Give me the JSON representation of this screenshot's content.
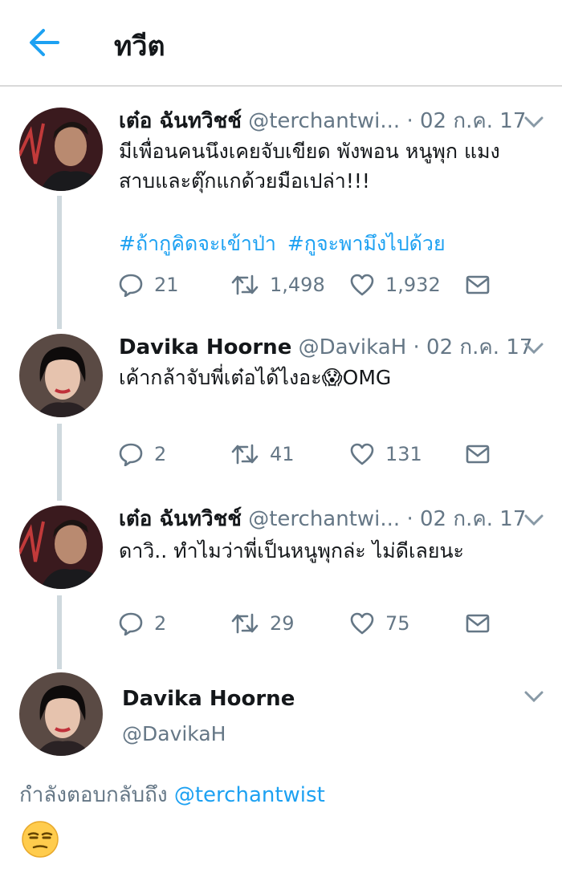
{
  "header": {
    "title": "ทวีต",
    "back_icon": "arrow-left-icon"
  },
  "tweets": [
    {
      "name": "เต๋อ ฉันทวิชช์",
      "handle": "@terchantwi...",
      "date": "· 02 ก.ค. 17",
      "lines": [
        "มีเพื่อนคนนึงเคยจับเขียด พังพอน หนูพุก แมง",
        "สาบและตุ๊กแกด้วยมือเปล่า!!!"
      ],
      "hashtags": [
        "#ถ้ากูคิดจะเข้าป่า",
        "#กูจะพามึงไปด้วย"
      ],
      "replies": "21",
      "retweets": "1,498",
      "likes": "1,932"
    },
    {
      "name": "Davika Hoorne",
      "handle": "@DavikaH",
      "date": "· 02 ก.ค. 17",
      "lines": [
        "เค้ากล้าจับพี่เต๋อได้ไงอะ😱OMG"
      ],
      "replies": "2",
      "retweets": "41",
      "likes": "131"
    },
    {
      "name": "เต๋อ ฉันทวิชช์",
      "handle": "@terchantwi...",
      "date": "· 02 ก.ค. 17",
      "lines": [
        "ดาวิ.. ทำไมว่าพี่เป็นหนูพุกล่ะ ไม่ดีเลยนะ"
      ],
      "replies": "2",
      "retweets": "29",
      "likes": "75"
    }
  ],
  "main_tweet": {
    "name": "Davika Hoorne",
    "handle": "@DavikaH",
    "replying_prefix": "กำลังตอบกลับถึง",
    "replying_mention": "@terchantwist",
    "emoji": "unamused-face"
  },
  "colors": {
    "accent": "#1da1f2",
    "secondary": "#657786",
    "thread": "#cfd9de",
    "text": "#14171a"
  }
}
